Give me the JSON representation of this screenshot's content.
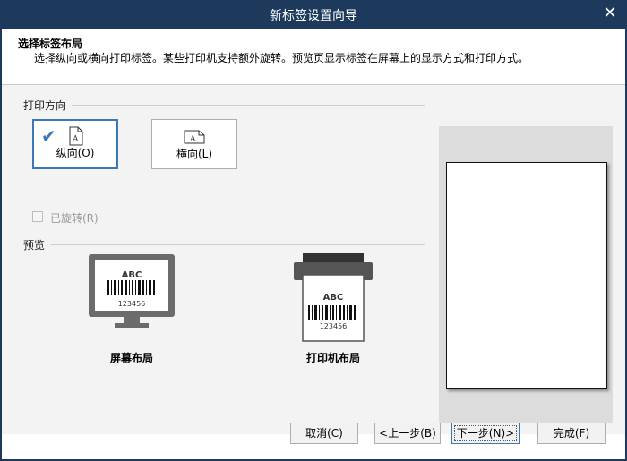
{
  "window": {
    "title": "新标签设置向导"
  },
  "header": {
    "heading": "选择标签布局",
    "description": "选择纵向或横向打印标签。某些打印机支持额外旋转。预览页显示标签在屏幕上的显示方式和打印方式。"
  },
  "orientation": {
    "section_label": "打印方向",
    "portrait_label": "纵向(O)",
    "landscape_label": "横向(L)",
    "selected": "portrait",
    "rotated_label": "已旋转(R)",
    "rotated_checked": false
  },
  "preview": {
    "section_label": "预览",
    "screen_layout_label": "屏幕布局",
    "printer_layout_label": "打印机布局",
    "sample_text": "ABC",
    "sample_number": "123456"
  },
  "footer": {
    "cancel": "取消(C)",
    "back": "<上一步(B)",
    "next": "下一步(N)>",
    "finish": "完成(F)"
  },
  "colors": {
    "titlebar": "#1d3a5c",
    "accent": "#3c78b4"
  }
}
